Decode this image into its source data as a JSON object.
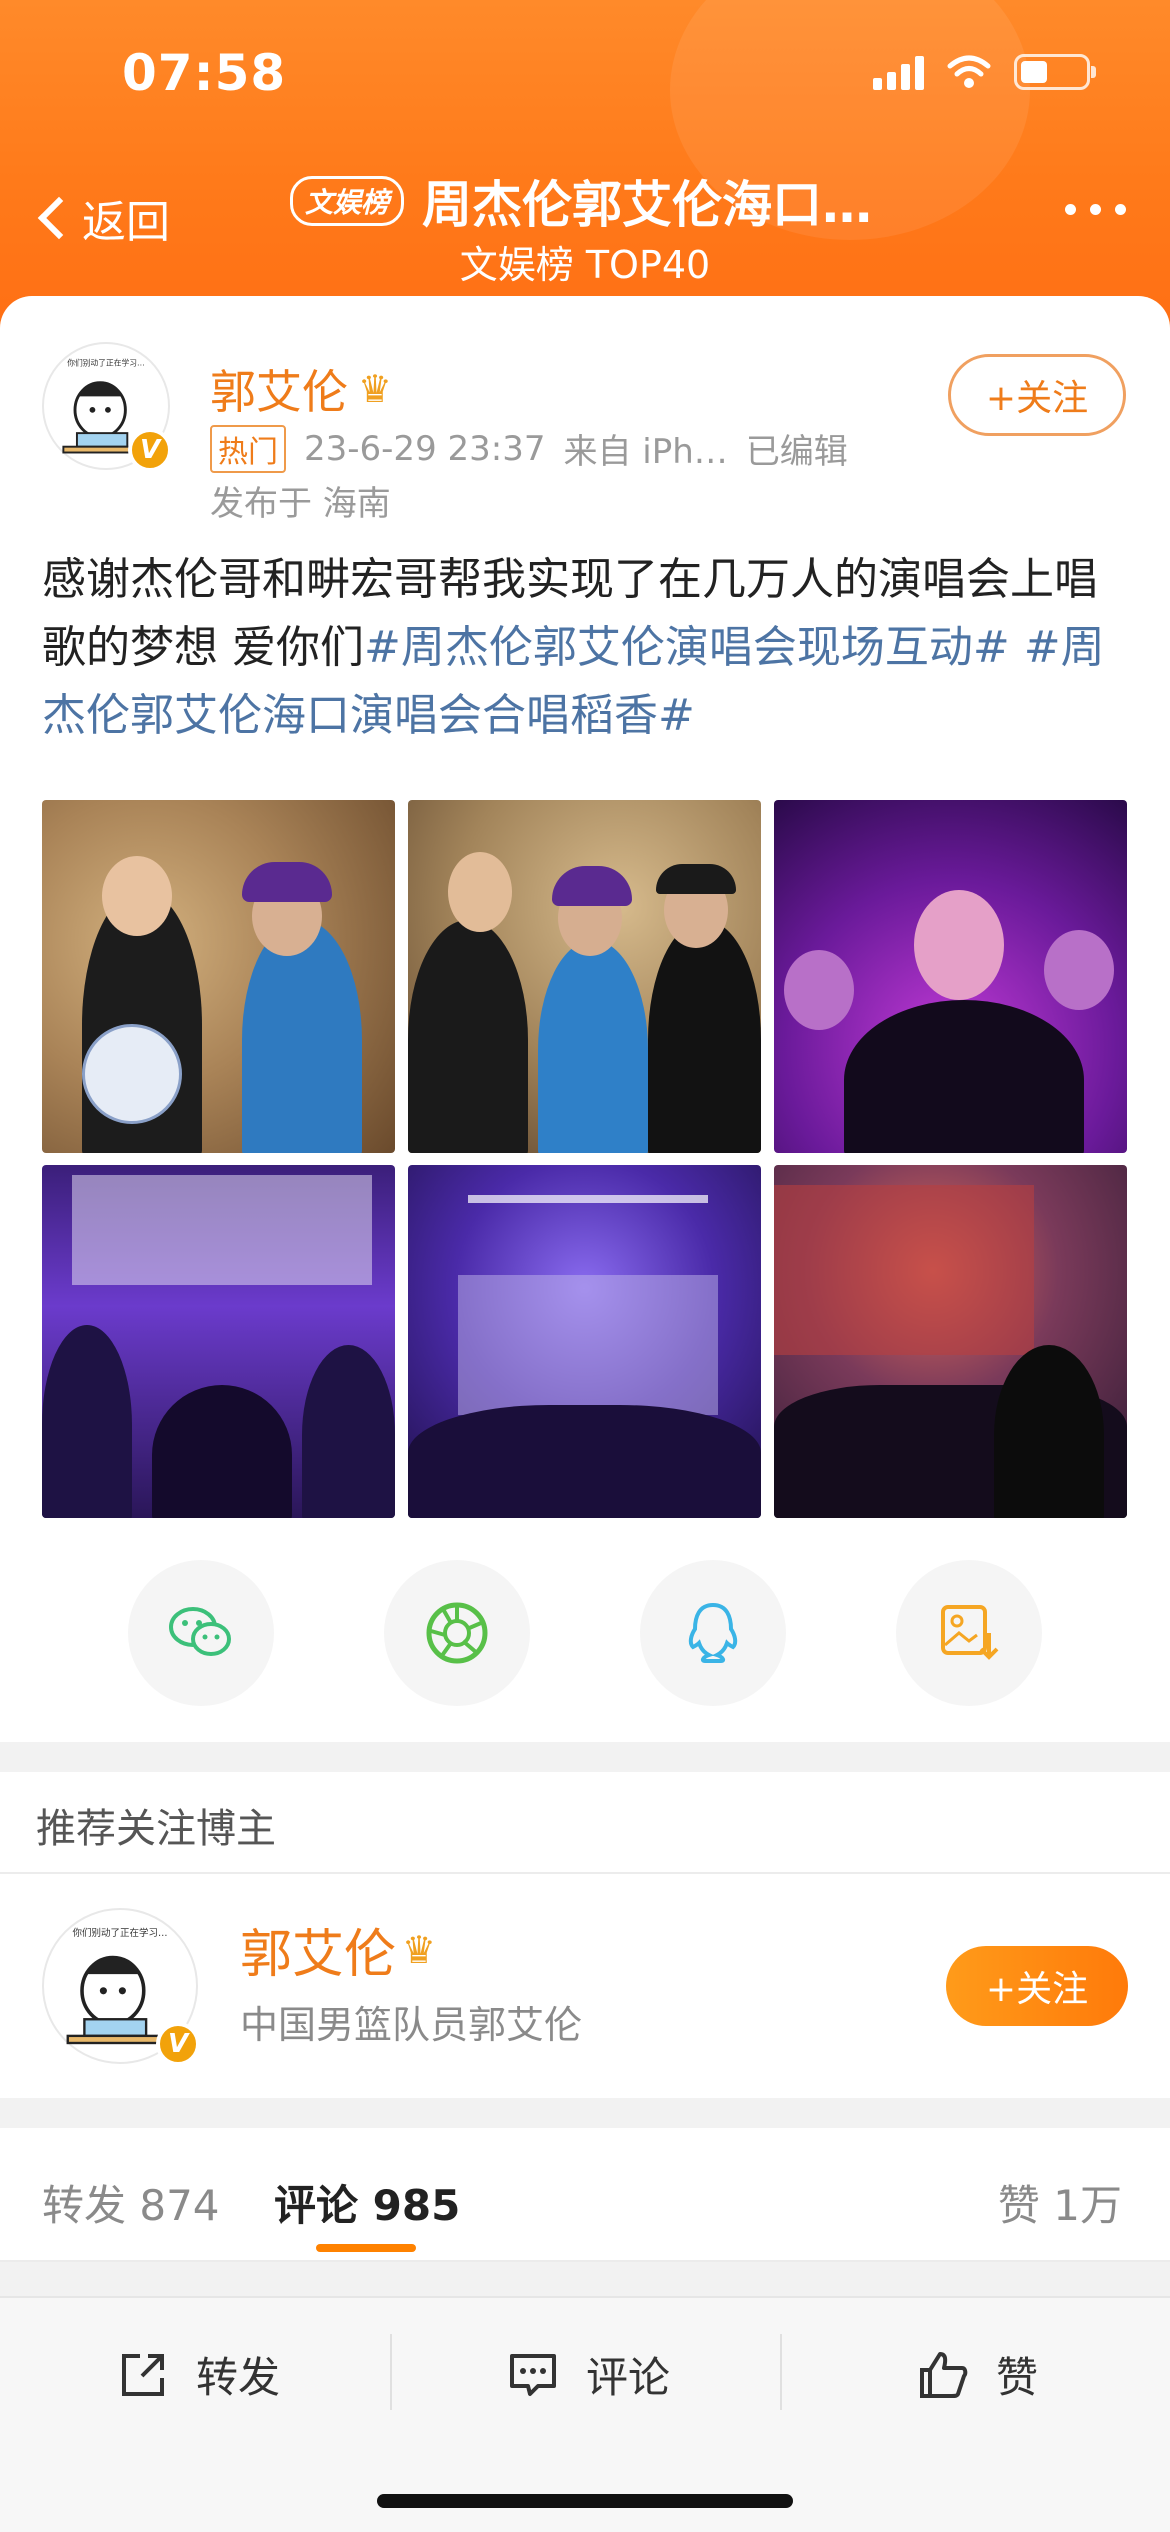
{
  "status_bar": {
    "time": "07:58"
  },
  "header": {
    "back_label": "返回",
    "badge": "文娱榜",
    "title": "周杰伦郭艾伦海口…",
    "subtitle": "文娱榜 TOP40"
  },
  "post": {
    "author": "郭艾伦",
    "hot_tag": "热门",
    "timestamp": "23-6-29 23:37",
    "source": "来自 iPh…",
    "edited": "已编辑",
    "location": "发布于 海南",
    "follow_label": "+关注",
    "text_plain": "感谢杰伦哥和畊宏哥帮我实现了在几万人的演唱会上唱歌的梦想 爱你们",
    "topic_1": "#周杰伦郭艾伦演唱会现场互动#",
    "topic_2": "#周杰伦郭艾伦海口演唱会合唱稻香#",
    "photos": [
      "photo-1",
      "photo-2",
      "photo-3",
      "photo-4",
      "photo-5",
      "photo-6"
    ]
  },
  "share_targets": [
    "wechat-icon",
    "moments-icon",
    "qq-icon",
    "save-image-icon"
  ],
  "recommend": {
    "section_title": "推荐关注博主",
    "name": "郭艾伦",
    "desc": "中国男篮队员郭艾伦",
    "follow_label": "+关注"
  },
  "tabs": {
    "repost": "转发 874",
    "comment": "评论 985",
    "like": "赞 1万"
  },
  "bottom_bar": {
    "repost": "转发",
    "comment": "评论",
    "like": "赞"
  },
  "colors": {
    "brand_orange": "#ff8200",
    "topic_blue": "#4d74a4"
  }
}
